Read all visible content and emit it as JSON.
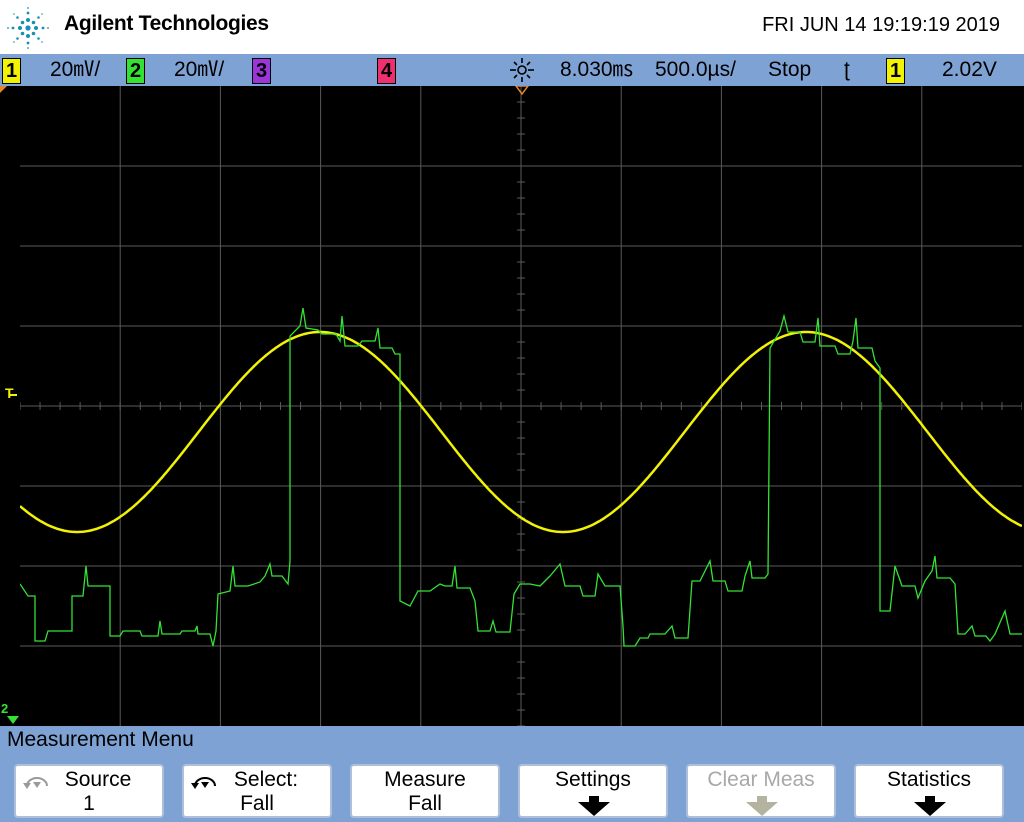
{
  "header": {
    "brand": "Agilent Technologies",
    "datetime": "FRI JUN 14 19:19:19 2019"
  },
  "status": {
    "ch1_label": "1",
    "ch1_scale": "20㎷/",
    "ch2_label": "2",
    "ch2_scale": "20㎷/",
    "ch3_label": "3",
    "ch4_label": "4",
    "delay": "8.030㎳",
    "timebase": "500.0µs/",
    "run_state": "Stop",
    "trigger_slope": "ʈ",
    "trigger_source": "1",
    "trigger_level": "2.02V",
    "colors": {
      "ch1": "#f2f205",
      "ch2": "#33e233",
      "ch3": "#9b35d8",
      "ch4": "#ef3070"
    }
  },
  "screen": {
    "trigger_marker": "T",
    "ch2_ground_marker": "2"
  },
  "menu": {
    "title": "Measurement Menu",
    "softkeys": [
      {
        "line1": "Source",
        "line2": "1",
        "icon": "rotate-knob-icon"
      },
      {
        "line1": "Select:",
        "line2": "Fall",
        "icon": "rotate-knob-icon"
      },
      {
        "line1": "Measure",
        "line2": "Fall"
      },
      {
        "line1": "Settings",
        "icon": "down-arrow-icon"
      },
      {
        "line1": "Clear Meas",
        "icon": "down-arrow-icon",
        "disabled": true
      },
      {
        "line1": "Statistics",
        "icon": "down-arrow-icon"
      }
    ]
  }
}
